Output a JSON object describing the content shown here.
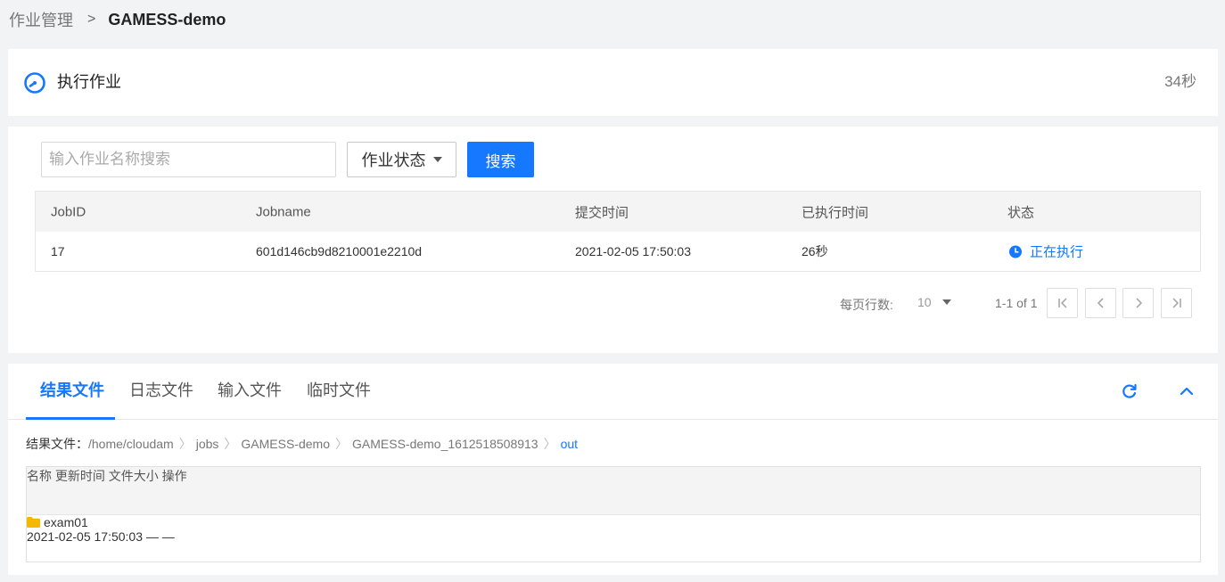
{
  "breadcrumb": {
    "root": "作业管理",
    "separator": ">",
    "current": "GAMESS-demo"
  },
  "exec": {
    "title": "执行作业",
    "elapsed": "34秒",
    "icon": "gauge-icon"
  },
  "search": {
    "placeholder": "输入作业名称搜索",
    "status_label": "作业状态",
    "button": "搜索"
  },
  "job_table": {
    "headers": [
      "JobID",
      "Jobname",
      "提交时间",
      "已执行时间",
      "状态"
    ],
    "rows": [
      {
        "id": "17",
        "name": "601d146cb9d8210001e2210d",
        "submit": "2021-02-05 17:50:03",
        "elapsed": "26秒",
        "status": "正在执行"
      }
    ]
  },
  "pager": {
    "rows_label": "每页行数:",
    "rows_per_page": "10",
    "range": "1-1 of 1"
  },
  "tabs": [
    "结果文件",
    "日志文件",
    "输入文件",
    "临时文件"
  ],
  "path": {
    "label": "结果文件：",
    "segments": [
      "/home/cloudam",
      "jobs",
      "GAMESS-demo",
      "GAMESS-demo_1612518508913",
      "out"
    ]
  },
  "file_table": {
    "headers": [
      "名称",
      "更新时间",
      "文件大小",
      "操作"
    ],
    "rows": [
      {
        "name": "exam01",
        "updated": "2021-02-05 17:50:03",
        "size": "—",
        "action": "—"
      }
    ]
  },
  "colors": {
    "accent": "#1677ff",
    "folder": "#f5b700"
  }
}
